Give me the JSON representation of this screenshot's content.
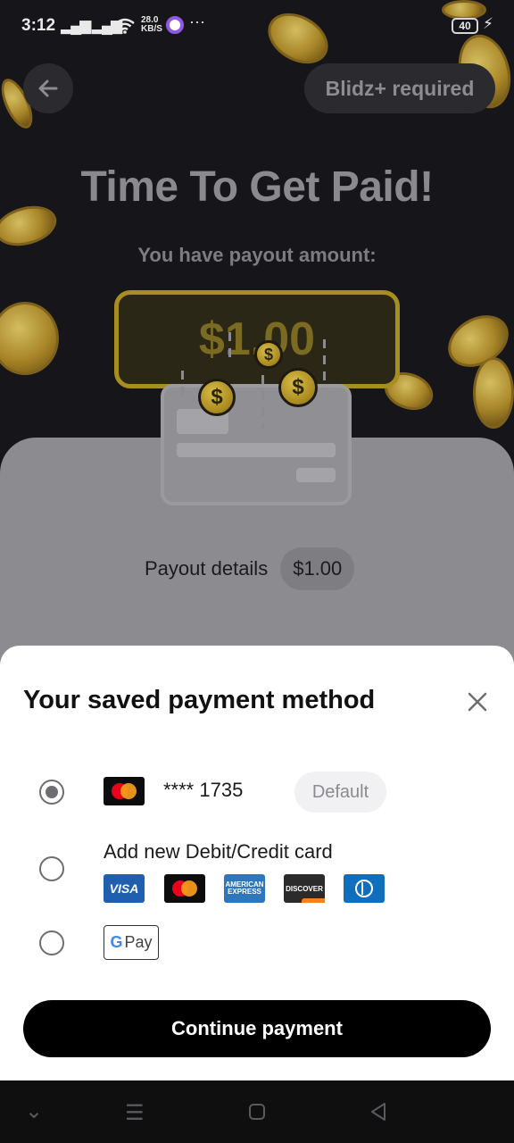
{
  "status_bar": {
    "time": "3:12",
    "speed_value": "28.0",
    "speed_unit": "KB/S",
    "battery": "40",
    "more": "···"
  },
  "header": {
    "back_icon": "arrow-left-icon",
    "required_label": "Blidz+ required"
  },
  "hero": {
    "title": "Time To Get Paid!",
    "subtitle": "You have payout amount:",
    "amount": "$1.00",
    "coin_symbol": "$"
  },
  "payout": {
    "label": "Payout details",
    "amount": "$1.00"
  },
  "sheet": {
    "title": "Your saved payment method",
    "close_icon": "close-icon",
    "options": [
      {
        "type": "saved-card",
        "brand": "mastercard",
        "masked_number": "**** 1735",
        "badge": "Default",
        "selected": true
      },
      {
        "type": "new-card",
        "label": "Add new Debit/Credit card",
        "brands": [
          "visa",
          "mastercard",
          "amex",
          "discover",
          "diners"
        ],
        "selected": false
      },
      {
        "type": "google-pay",
        "label": "Pay",
        "selected": false
      }
    ],
    "brand_text": {
      "visa": "VISA",
      "amex": "AMERICAN EXPRESS",
      "discover": "DISCOVER"
    },
    "continue_label": "Continue payment"
  },
  "colors": {
    "accent_gold": "#a88e1e",
    "button": "#000000",
    "sheet_bg": "#ffffff"
  }
}
